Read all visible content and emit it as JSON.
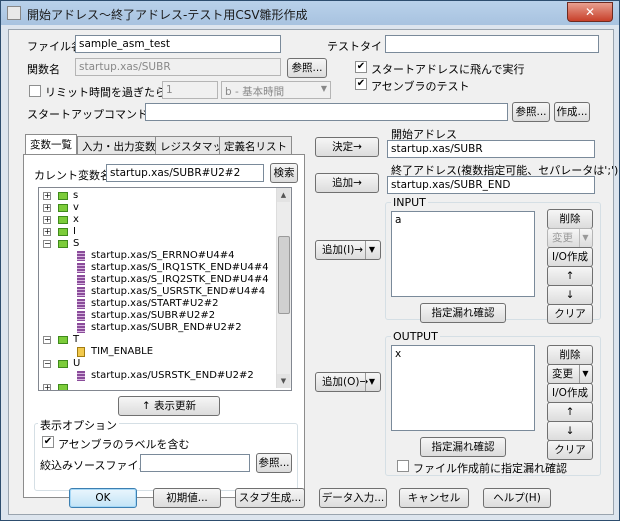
{
  "window": {
    "title": "開始アドレス～終了アドレス-テスト用CSV雛形作成",
    "close_glyph": "✕"
  },
  "top": {
    "file_label": "ファイル名",
    "file_value": "sample_asm_test",
    "test_title_label": "テストタイトル",
    "test_title_value": "",
    "func_label": "関数名",
    "func_value": "startup.xas/SUBR",
    "browse_label": "参照...",
    "start_jump_label": "スタートアドレスに飛んで実行",
    "start_jump_checked": "✔",
    "asm_test_label": "アセンブラのテスト",
    "asm_test_checked": "✔",
    "limit_label": "リミット時間を過ぎたら停止",
    "limit_value": "1",
    "limit_unit": "b - 基本時間",
    "startup_cmd_label": "スタートアップコマンドファイル:",
    "startup_cmd_value": "",
    "browse2_label": "参照...",
    "create_label": "作成..."
  },
  "tabs": [
    {
      "label": "変数一覧"
    },
    {
      "label": "入力・出力変数"
    },
    {
      "label": "レジスタマップ"
    },
    {
      "label": "定義名リスト"
    }
  ],
  "varlist": {
    "current_label": "カレント変数名",
    "current_value": "startup.xas/SUBR#U2#2",
    "search_label": "検索",
    "tree": [
      {
        "text": "s",
        "type": "folder"
      },
      {
        "text": "v",
        "type": "folder"
      },
      {
        "text": "x",
        "type": "folder"
      },
      {
        "text": "I",
        "type": "folder"
      },
      {
        "text": "S",
        "type": "folder"
      },
      {
        "text": "startup.xas/S_ERRNO#U4#4",
        "type": "leaf"
      },
      {
        "text": "startup.xas/S_IRQ1STK_END#U4#4",
        "type": "leaf"
      },
      {
        "text": "startup.xas/S_IRQ2STK_END#U4#4",
        "type": "leaf"
      },
      {
        "text": "startup.xas/S_USRSTK_END#U4#4",
        "type": "leaf"
      },
      {
        "text": "startup.xas/START#U2#2",
        "type": "leaf"
      },
      {
        "text": "startup.xas/SUBR#U2#2",
        "type": "leaf"
      },
      {
        "text": "startup.xas/SUBR_END#U2#2",
        "type": "leaf"
      },
      {
        "text": "T",
        "type": "folder"
      },
      {
        "text": "TIM_ENABLE",
        "type": "leaf"
      },
      {
        "text": "U",
        "type": "folder"
      },
      {
        "text": "startup.xas/USRSTK_END#U2#2",
        "type": "leaf"
      },
      {
        "text": "_",
        "type": "folder"
      }
    ],
    "refresh_label": "↑ 表示更新",
    "display_options_label": "表示オプション",
    "include_asm_label": "アセンブラのラベルを含む",
    "include_asm_checked": "✔",
    "filter_label": "絞込みソースファイル名",
    "filter_value": "",
    "browse_label": "参照..."
  },
  "middle": {
    "decide_label": "決定→",
    "add_label": "追加→",
    "add_i_label": "追加(I)→",
    "add_o_label": "追加(O)→",
    "dropdown_glyph": "▼"
  },
  "right": {
    "start_addr_label": "開始アドレス",
    "start_addr_value": "startup.xas/SUBR",
    "end_addr_label": "終了アドレス(複数指定可能、セパレータは';')",
    "end_addr_value": "startup.xas/SUBR_END",
    "input_label": "INPUT",
    "input_value": "a",
    "output_label": "OUTPUT",
    "output_value": "x",
    "delete_label": "削除",
    "change_label": "変更",
    "io_create_label": "I/O作成",
    "up_label": "↑",
    "down_label": "↓",
    "clear_label": "クリア",
    "check_missing_label": "指定漏れ確認",
    "check_before_create_label": "ファイル作成前に指定漏れ確認"
  },
  "bottom": {
    "ok_label": "OK",
    "init_label": "初期値...",
    "stub_label": "スタブ生成...",
    "data_input_label": "データ入力...",
    "cancel_label": "キャンセル",
    "help_label": "ヘルプ(H)"
  }
}
